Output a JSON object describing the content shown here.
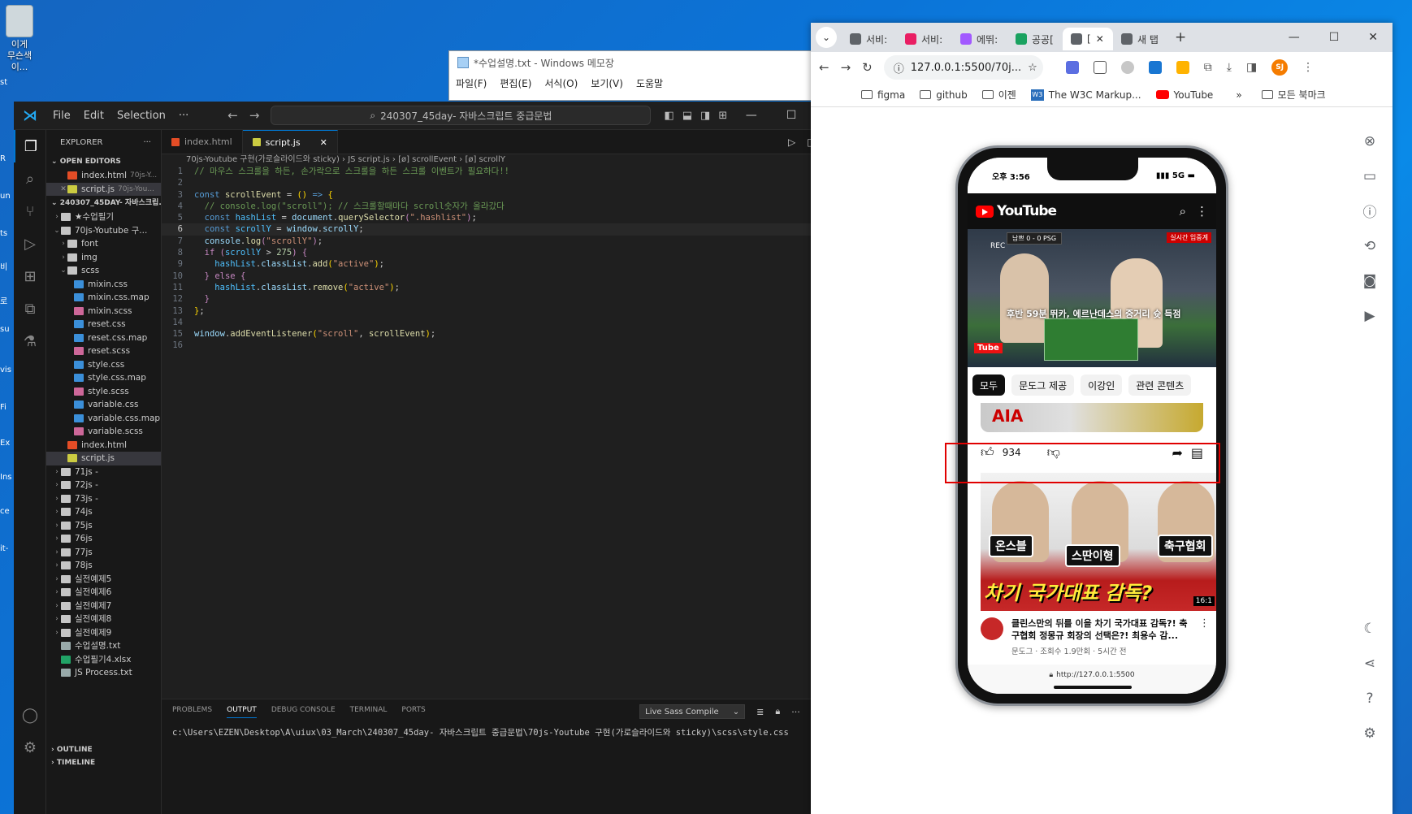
{
  "desktop": {
    "icon_label": "이게\n무슨색이...",
    "edge_labels": [
      "st",
      "R",
      "un",
      "ts",
      "비",
      "로",
      "su",
      "vis",
      "Fi",
      "Ex",
      "Ins",
      "ce",
      "it-"
    ]
  },
  "notepad": {
    "title": "*수업설명.txt - Windows 메모장",
    "menu": [
      "파일(F)",
      "편집(E)",
      "서식(O)",
      "보기(V)",
      "도움말"
    ]
  },
  "vscode": {
    "menu": [
      "File",
      "Edit",
      "Selection",
      "···"
    ],
    "search_text": "240307_45day- 자바스크립트 중급문법",
    "explorer_title": "EXPLORER",
    "open_editors_label": "OPEN EDITORS",
    "open_editors": [
      {
        "name": "index.html",
        "hint": "70js-Y..."
      },
      {
        "name": "script.js",
        "hint": "70js-You..."
      }
    ],
    "workspace_label": "240307_45DAY- 자바스크립...",
    "tree": [
      {
        "label": "★수업필기",
        "type": "fold",
        "depth": 1
      },
      {
        "label": "70js-Youtube 구...",
        "type": "fold",
        "depth": 1,
        "open": true
      },
      {
        "label": "font",
        "type": "fold",
        "depth": 2
      },
      {
        "label": "img",
        "type": "fold",
        "depth": 2
      },
      {
        "label": "scss",
        "type": "fold",
        "depth": 2,
        "open": true
      },
      {
        "label": "mixin.css",
        "type": "css",
        "depth": 3
      },
      {
        "label": "mixin.css.map",
        "type": "css",
        "depth": 3
      },
      {
        "label": "mixin.scss",
        "type": "scss",
        "depth": 3
      },
      {
        "label": "reset.css",
        "type": "css",
        "depth": 3
      },
      {
        "label": "reset.css.map",
        "type": "css",
        "depth": 3
      },
      {
        "label": "reset.scss",
        "type": "scss",
        "depth": 3
      },
      {
        "label": "style.css",
        "type": "css",
        "depth": 3
      },
      {
        "label": "style.css.map",
        "type": "css",
        "depth": 3
      },
      {
        "label": "style.scss",
        "type": "scss",
        "depth": 3
      },
      {
        "label": "variable.css",
        "type": "css",
        "depth": 3
      },
      {
        "label": "variable.css.map",
        "type": "css",
        "depth": 3
      },
      {
        "label": "variable.scss",
        "type": "scss",
        "depth": 3
      },
      {
        "label": "index.html",
        "type": "html",
        "depth": 2
      },
      {
        "label": "script.js",
        "type": "js",
        "depth": 2,
        "selected": true
      },
      {
        "label": "71js -",
        "type": "fold",
        "depth": 1
      },
      {
        "label": "72js -",
        "type": "fold",
        "depth": 1
      },
      {
        "label": "73js -",
        "type": "fold",
        "depth": 1
      },
      {
        "label": "74js",
        "type": "fold",
        "depth": 1
      },
      {
        "label": "75js",
        "type": "fold",
        "depth": 1
      },
      {
        "label": "76js",
        "type": "fold",
        "depth": 1
      },
      {
        "label": "77js",
        "type": "fold",
        "depth": 1
      },
      {
        "label": "78js",
        "type": "fold",
        "depth": 1
      },
      {
        "label": "실전예제5",
        "type": "fold",
        "depth": 1
      },
      {
        "label": "실전예제6",
        "type": "fold",
        "depth": 1
      },
      {
        "label": "실전예제7",
        "type": "fold",
        "depth": 1
      },
      {
        "label": "실전예제8",
        "type": "fold",
        "depth": 1
      },
      {
        "label": "실전예제9",
        "type": "fold",
        "depth": 1
      },
      {
        "label": "수업설명.txt",
        "type": "txt",
        "depth": 1
      },
      {
        "label": "수업필기4.xlsx",
        "type": "xls",
        "depth": 1
      },
      {
        "label": "JS Process.txt",
        "type": "txt",
        "depth": 1
      }
    ],
    "outline_label": "OUTLINE",
    "timeline_label": "TIMELINE",
    "tabs": [
      {
        "name": "index.html",
        "icon": "html"
      },
      {
        "name": "script.js",
        "icon": "js",
        "active": true
      }
    ],
    "breadcrumb": "70js-Youtube 구현(가로슬라이드와 sticky) › JS script.js › [ø] scrollEvent › [ø] scrollY",
    "current_line": 6,
    "code": [
      "<span class='cm'>// 마우스 스크롤을 하든, 손가락으로 스크롤을 하든 스크롤 이벤트가 필요하다!!</span>",
      "",
      "<span class='kw'>const</span> <span class='fn'>scrollEvent</span> <span class='pn'>=</span> <span class='br'>()</span> <span class='kw'>=&gt;</span> <span class='br'>{</span>",
      "  <span class='cm'>// console.log(\"scroll\"); // 스크롤할때마다 scroll숫자가 올라갔다</span>",
      "  <span class='kw'>const</span> <span class='vr'>hashList</span> <span class='pn'>=</span> <span class='pm'>document</span>.<span class='fn'>querySelector</span><span class='ctl'>(</span><span class='st'>\".hashlist\"</span><span class='ctl'>)</span>;",
      "  <span class='kw'>const</span> <span class='vr'>scrollY</span> <span class='pn'>=</span> <span class='pm'>window</span>.<span class='pm'>scrollY</span>;",
      "  <span class='pm'>console</span>.<span class='fn'>log</span><span class='ctl'>(</span><span class='st'>\"scrollY\"</span><span class='ctl'>)</span>;",
      "  <span class='ctl'>if</span> <span class='ctl'>(</span><span class='vr'>scrollY</span> <span class='pn'>&gt;</span> <span class='nm'>275</span><span class='ctl'>)</span> <span class='ctl'>{</span>",
      "    <span class='vr'>hashList</span>.<span class='pm'>classList</span>.<span class='fn'>add</span><span class='br'>(</span><span class='st'>\"active\"</span><span class='br'>)</span>;",
      "  <span class='ctl'>}</span> <span class='ctl'>else</span> <span class='ctl'>{</span>",
      "    <span class='vr'>hashList</span>.<span class='pm'>classList</span>.<span class='fn'>remove</span><span class='br'>(</span><span class='st'>\"active\"</span><span class='br'>)</span>;",
      "  <span class='ctl'>}</span>",
      "<span class='br'>}</span>;",
      "",
      "<span class='pm'>window</span>.<span class='fn'>addEventListener</span><span class='br'>(</span><span class='st'>\"scroll\"</span>, <span class='fn'>scrollEvent</span><span class='br'>)</span>;",
      ""
    ],
    "panel_tabs": [
      "PROBLEMS",
      "OUTPUT",
      "DEBUG CONSOLE",
      "TERMINAL",
      "PORTS"
    ],
    "panel_active": "OUTPUT",
    "output_channel": "Live Sass Compile",
    "output_text": "c:\\Users\\EZEN\\Desktop\\A\\uiux\\03_March\\240307_45day- 자바스크립트 중급문법\\70js-Youtube 구현(가로슬라이드와 sticky)\\scss\\style.css"
  },
  "chrome": {
    "tabs": [
      {
        "label": "서비:",
        "color": "#5f6368"
      },
      {
        "label": "서비:",
        "color": "#e91e63"
      },
      {
        "label": "에뛰:",
        "color": "#a259ff"
      },
      {
        "label": "공공[",
        "color": "#1aa260"
      },
      {
        "label": "[",
        "color": "#5f6368",
        "active": true
      },
      {
        "label": "새 탭",
        "color": "#5f6368"
      }
    ],
    "new_tab": "+",
    "url": "127.0.0.1:5500/70j...",
    "avatar": "SJ",
    "bookmarks": [
      {
        "label": "figma",
        "icon": "folder"
      },
      {
        "label": "github",
        "icon": "folder"
      },
      {
        "label": "이젠",
        "icon": "folder"
      },
      {
        "label": "The W3C Markup...",
        "icon": "w3c"
      },
      {
        "label": "YouTube",
        "icon": "youtube"
      }
    ],
    "bookmarks_more": "»",
    "all_bookmarks": "모든 북마크"
  },
  "phone": {
    "time": "오후 3:56",
    "signal": "5G",
    "yt_logo": "YouTube",
    "video_caption": "후반 59분 뛰카, 에르난데스의 중거리 슛 득점",
    "video_rec": "REC",
    "video_score": "남쁘  0 - 0  PSG",
    "video_live": "실시간 입중계",
    "chips": [
      "모두",
      "문도그 제공",
      "이강인",
      "관련 콘텐츠"
    ],
    "likes": "934",
    "video2_tags": [
      "온스블",
      "스딴이형",
      "축구협회"
    ],
    "video2_headline": "차기 국가대표 감독?",
    "video2_duration": "16:1",
    "video2_title": "클린스만의 뒤를 이을 차기 국가대표 감독?! 축구협회 정몽규 회장의 선택은?! 최용수 감...",
    "video2_sub": "문도그 · 조회수 1.9만회 · 5시간 전",
    "url": "http://127.0.0.1:5500"
  }
}
